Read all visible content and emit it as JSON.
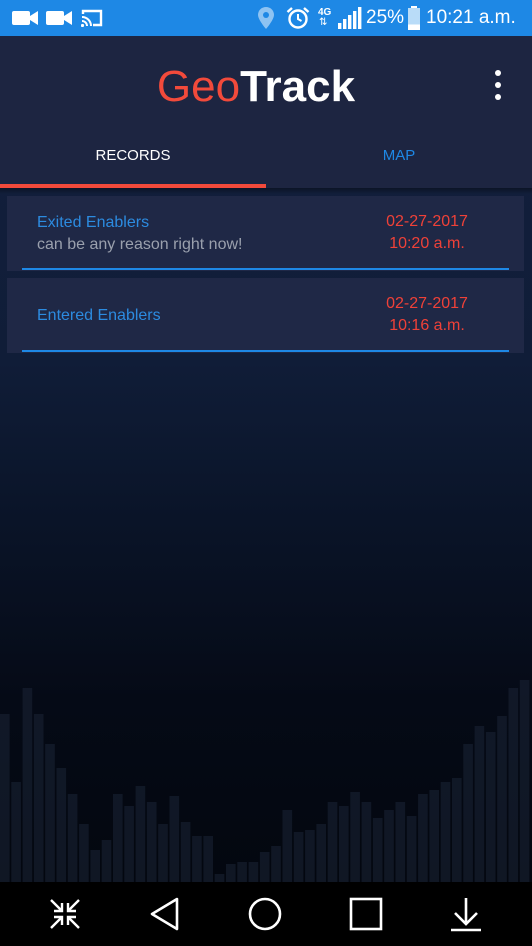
{
  "status_bar": {
    "battery": "25%",
    "time": "10:21 a.m.",
    "network": "4G",
    "left_icons": [
      "video-camera-icon",
      "video-camera-icon",
      "cast-icon"
    ],
    "right_icons": [
      "location-icon",
      "alarm-icon",
      "network-4g-icon",
      "signal-icon",
      "battery-icon"
    ],
    "battery_level": 0.25
  },
  "header": {
    "logo_part1": "Geo",
    "logo_part2": "Track",
    "menu_icon": "more-vert-icon"
  },
  "tabs": [
    {
      "label": "RECORDS",
      "selected": true
    },
    {
      "label": "MAP",
      "selected": false
    }
  ],
  "records": [
    {
      "title": "Exited Enablers",
      "note": "can be any reason right now!",
      "date": "02-27-2017",
      "time": "10:20 a.m."
    },
    {
      "title": "Entered Enablers",
      "note": "",
      "date": "02-27-2017",
      "time": "10:16 a.m."
    }
  ],
  "nav_bar": {
    "icons": [
      "collapse-icon",
      "back-icon",
      "home-icon",
      "recents-icon",
      "download-icon"
    ]
  },
  "colors": {
    "accent_red": "#f24a3b",
    "accent_blue": "#1e88e5",
    "header_bg": "#1d2541",
    "card_bg": "#1f2846",
    "status_bar": "#1e88e5"
  }
}
